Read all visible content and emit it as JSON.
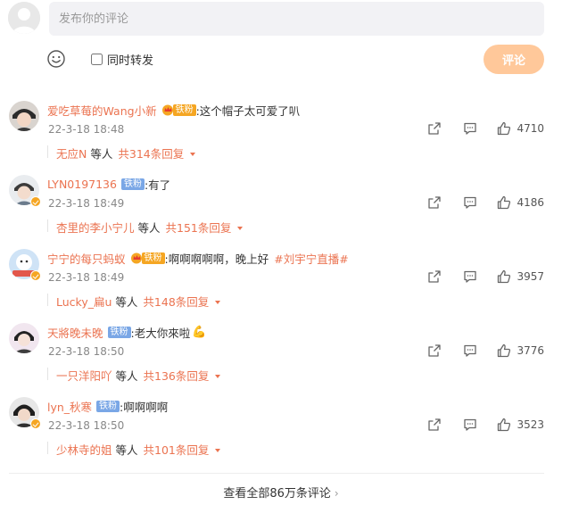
{
  "composer": {
    "placeholder": "发布你的评论",
    "repost_label": "同时转发",
    "submit_label": "评论"
  },
  "comments": [
    {
      "username": "爱吃草莓的Wang小新",
      "badge": "铁粉",
      "badge_style": "gold-crown",
      "text": ":这个帽子太可爱了叭",
      "topic": "",
      "time": "22-3-18 18:48",
      "likes": "4710",
      "reply_user": "无应N",
      "reply_mid": "等人",
      "reply_count": "共314条回复"
    },
    {
      "username": "LYN0197136",
      "badge": "铁粉",
      "badge_style": "blue",
      "text": ":有了",
      "topic": "",
      "time": "22-3-18 18:49",
      "likes": "4186",
      "reply_user": "杏里的李小宁儿",
      "reply_mid": "等人",
      "reply_count": "共151条回复"
    },
    {
      "username": "宁宁的每只蚂蚁",
      "badge": "铁粉",
      "badge_style": "gold-crown",
      "text": ":啊啊啊啊啊，晚上好",
      "topic": "#刘宇宁直播#",
      "time": "22-3-18 18:49",
      "likes": "3957",
      "reply_user": "Lucky_扁u",
      "reply_mid": "等人",
      "reply_count": "共148条回复"
    },
    {
      "username": "天將晚未晚",
      "badge": "铁粉",
      "badge_style": "blue",
      "text": ":老大你來啦",
      "topic": "",
      "time": "22-3-18 18:50",
      "likes": "3776",
      "reply_user": "一只洋阳吖",
      "reply_mid": "等人",
      "reply_count": "共136条回复"
    },
    {
      "username": "lyn_秋寒",
      "badge": "铁粉",
      "badge_style": "blue",
      "text": ":啊啊啊啊",
      "topic": "",
      "time": "22-3-18 18:50",
      "likes": "3523",
      "reply_user": "少林寺的姐",
      "reply_mid": "等人",
      "reply_count": "共101条回复"
    }
  ],
  "footer": {
    "view_all": "查看全部86万条评论"
  },
  "colors": {
    "accent": "#eb7350",
    "submit_disabled": "#ffc89a",
    "badge_gold": "#f5a623",
    "badge_blue": "#7aa7e6"
  }
}
